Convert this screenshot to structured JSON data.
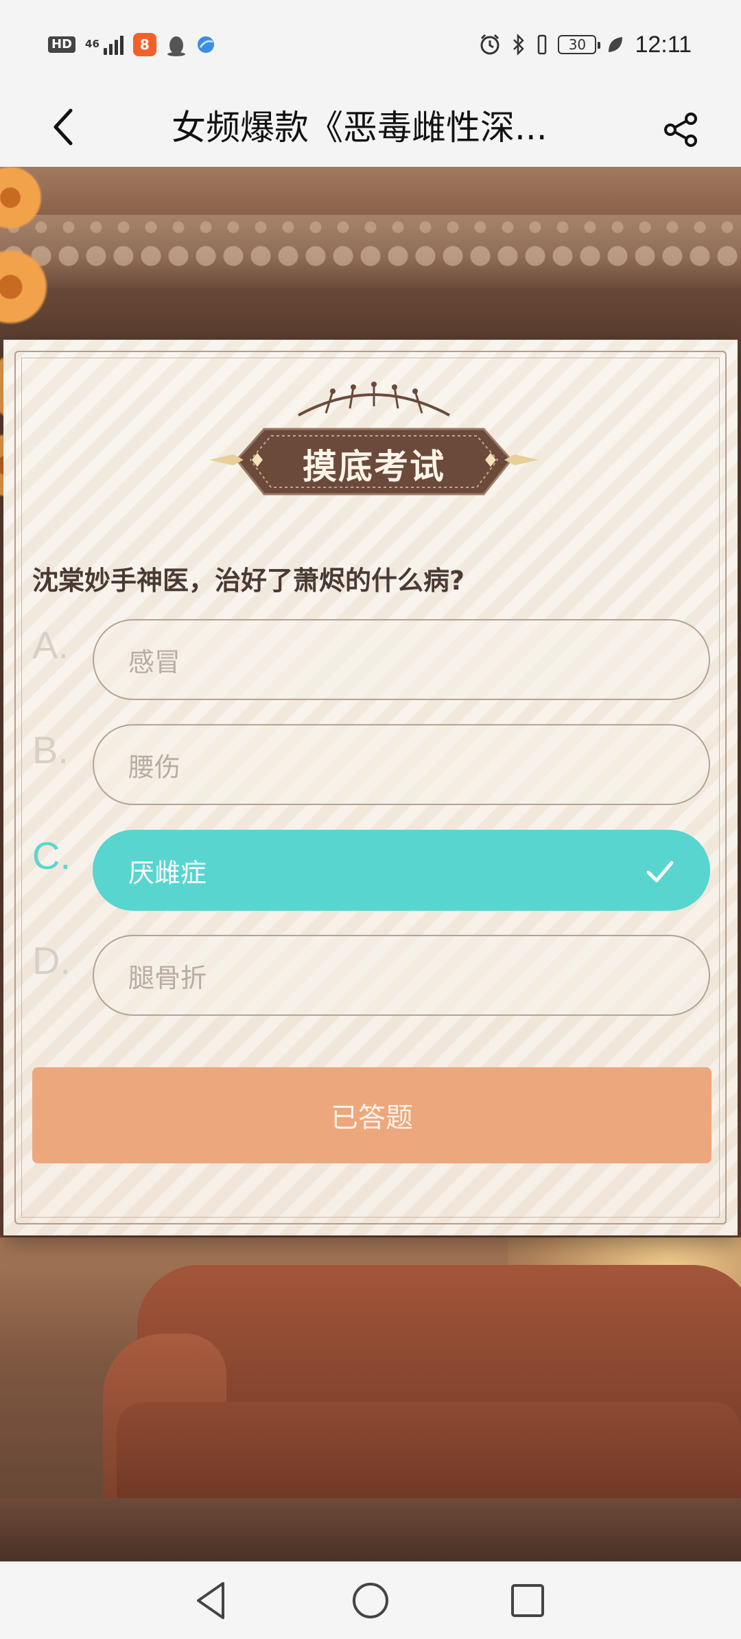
{
  "status_bar": {
    "hd": "HD",
    "network": "46",
    "app_badge": "8",
    "battery": "30",
    "time": "12:11"
  },
  "nav": {
    "title": "女频爆款《恶毒雌性深...",
    "back_icon": "chevron-left-icon",
    "share_icon": "share-icon"
  },
  "quiz": {
    "title": "摸底考试",
    "question": "沈棠妙手神医，治好了萧烬的什么病?",
    "options": [
      {
        "letter": "A.",
        "text": "感冒",
        "selected": false
      },
      {
        "letter": "B.",
        "text": "腰伤",
        "selected": false
      },
      {
        "letter": "C.",
        "text": "厌雌症",
        "selected": true
      },
      {
        "letter": "D.",
        "text": "腿骨折",
        "selected": false
      }
    ],
    "submit_label": "已答题",
    "colors": {
      "selected": "#58d5cf",
      "button": "#eca77d",
      "plaque": "#6b4a3c"
    }
  },
  "system_nav": {
    "back": "triangle-back-icon",
    "home": "circle-home-icon",
    "recents": "square-recents-icon"
  }
}
